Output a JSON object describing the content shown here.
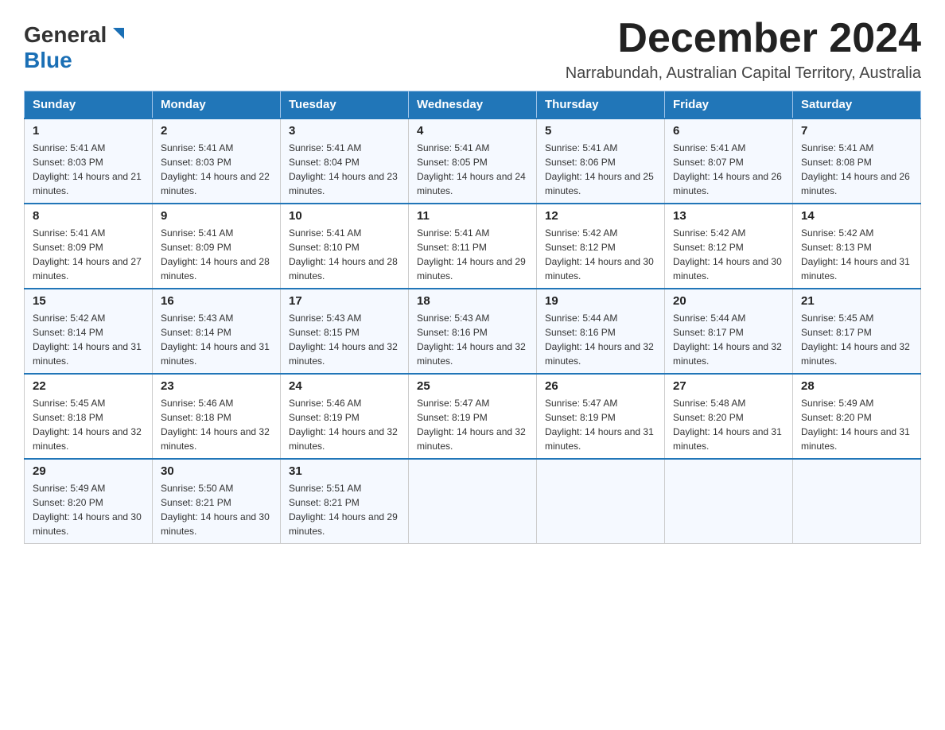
{
  "header": {
    "logo_general": "General",
    "logo_blue": "Blue",
    "month_title": "December 2024",
    "location": "Narrabundah, Australian Capital Territory, Australia"
  },
  "columns": [
    "Sunday",
    "Monday",
    "Tuesday",
    "Wednesday",
    "Thursday",
    "Friday",
    "Saturday"
  ],
  "weeks": [
    [
      {
        "day": "1",
        "sunrise": "Sunrise: 5:41 AM",
        "sunset": "Sunset: 8:03 PM",
        "daylight": "Daylight: 14 hours and 21 minutes."
      },
      {
        "day": "2",
        "sunrise": "Sunrise: 5:41 AM",
        "sunset": "Sunset: 8:03 PM",
        "daylight": "Daylight: 14 hours and 22 minutes."
      },
      {
        "day": "3",
        "sunrise": "Sunrise: 5:41 AM",
        "sunset": "Sunset: 8:04 PM",
        "daylight": "Daylight: 14 hours and 23 minutes."
      },
      {
        "day": "4",
        "sunrise": "Sunrise: 5:41 AM",
        "sunset": "Sunset: 8:05 PM",
        "daylight": "Daylight: 14 hours and 24 minutes."
      },
      {
        "day": "5",
        "sunrise": "Sunrise: 5:41 AM",
        "sunset": "Sunset: 8:06 PM",
        "daylight": "Daylight: 14 hours and 25 minutes."
      },
      {
        "day": "6",
        "sunrise": "Sunrise: 5:41 AM",
        "sunset": "Sunset: 8:07 PM",
        "daylight": "Daylight: 14 hours and 26 minutes."
      },
      {
        "day": "7",
        "sunrise": "Sunrise: 5:41 AM",
        "sunset": "Sunset: 8:08 PM",
        "daylight": "Daylight: 14 hours and 26 minutes."
      }
    ],
    [
      {
        "day": "8",
        "sunrise": "Sunrise: 5:41 AM",
        "sunset": "Sunset: 8:09 PM",
        "daylight": "Daylight: 14 hours and 27 minutes."
      },
      {
        "day": "9",
        "sunrise": "Sunrise: 5:41 AM",
        "sunset": "Sunset: 8:09 PM",
        "daylight": "Daylight: 14 hours and 28 minutes."
      },
      {
        "day": "10",
        "sunrise": "Sunrise: 5:41 AM",
        "sunset": "Sunset: 8:10 PM",
        "daylight": "Daylight: 14 hours and 28 minutes."
      },
      {
        "day": "11",
        "sunrise": "Sunrise: 5:41 AM",
        "sunset": "Sunset: 8:11 PM",
        "daylight": "Daylight: 14 hours and 29 minutes."
      },
      {
        "day": "12",
        "sunrise": "Sunrise: 5:42 AM",
        "sunset": "Sunset: 8:12 PM",
        "daylight": "Daylight: 14 hours and 30 minutes."
      },
      {
        "day": "13",
        "sunrise": "Sunrise: 5:42 AM",
        "sunset": "Sunset: 8:12 PM",
        "daylight": "Daylight: 14 hours and 30 minutes."
      },
      {
        "day": "14",
        "sunrise": "Sunrise: 5:42 AM",
        "sunset": "Sunset: 8:13 PM",
        "daylight": "Daylight: 14 hours and 31 minutes."
      }
    ],
    [
      {
        "day": "15",
        "sunrise": "Sunrise: 5:42 AM",
        "sunset": "Sunset: 8:14 PM",
        "daylight": "Daylight: 14 hours and 31 minutes."
      },
      {
        "day": "16",
        "sunrise": "Sunrise: 5:43 AM",
        "sunset": "Sunset: 8:14 PM",
        "daylight": "Daylight: 14 hours and 31 minutes."
      },
      {
        "day": "17",
        "sunrise": "Sunrise: 5:43 AM",
        "sunset": "Sunset: 8:15 PM",
        "daylight": "Daylight: 14 hours and 32 minutes."
      },
      {
        "day": "18",
        "sunrise": "Sunrise: 5:43 AM",
        "sunset": "Sunset: 8:16 PM",
        "daylight": "Daylight: 14 hours and 32 minutes."
      },
      {
        "day": "19",
        "sunrise": "Sunrise: 5:44 AM",
        "sunset": "Sunset: 8:16 PM",
        "daylight": "Daylight: 14 hours and 32 minutes."
      },
      {
        "day": "20",
        "sunrise": "Sunrise: 5:44 AM",
        "sunset": "Sunset: 8:17 PM",
        "daylight": "Daylight: 14 hours and 32 minutes."
      },
      {
        "day": "21",
        "sunrise": "Sunrise: 5:45 AM",
        "sunset": "Sunset: 8:17 PM",
        "daylight": "Daylight: 14 hours and 32 minutes."
      }
    ],
    [
      {
        "day": "22",
        "sunrise": "Sunrise: 5:45 AM",
        "sunset": "Sunset: 8:18 PM",
        "daylight": "Daylight: 14 hours and 32 minutes."
      },
      {
        "day": "23",
        "sunrise": "Sunrise: 5:46 AM",
        "sunset": "Sunset: 8:18 PM",
        "daylight": "Daylight: 14 hours and 32 minutes."
      },
      {
        "day": "24",
        "sunrise": "Sunrise: 5:46 AM",
        "sunset": "Sunset: 8:19 PM",
        "daylight": "Daylight: 14 hours and 32 minutes."
      },
      {
        "day": "25",
        "sunrise": "Sunrise: 5:47 AM",
        "sunset": "Sunset: 8:19 PM",
        "daylight": "Daylight: 14 hours and 32 minutes."
      },
      {
        "day": "26",
        "sunrise": "Sunrise: 5:47 AM",
        "sunset": "Sunset: 8:19 PM",
        "daylight": "Daylight: 14 hours and 31 minutes."
      },
      {
        "day": "27",
        "sunrise": "Sunrise: 5:48 AM",
        "sunset": "Sunset: 8:20 PM",
        "daylight": "Daylight: 14 hours and 31 minutes."
      },
      {
        "day": "28",
        "sunrise": "Sunrise: 5:49 AM",
        "sunset": "Sunset: 8:20 PM",
        "daylight": "Daylight: 14 hours and 31 minutes."
      }
    ],
    [
      {
        "day": "29",
        "sunrise": "Sunrise: 5:49 AM",
        "sunset": "Sunset: 8:20 PM",
        "daylight": "Daylight: 14 hours and 30 minutes."
      },
      {
        "day": "30",
        "sunrise": "Sunrise: 5:50 AM",
        "sunset": "Sunset: 8:21 PM",
        "daylight": "Daylight: 14 hours and 30 minutes."
      },
      {
        "day": "31",
        "sunrise": "Sunrise: 5:51 AM",
        "sunset": "Sunset: 8:21 PM",
        "daylight": "Daylight: 14 hours and 29 minutes."
      },
      null,
      null,
      null,
      null
    ]
  ]
}
